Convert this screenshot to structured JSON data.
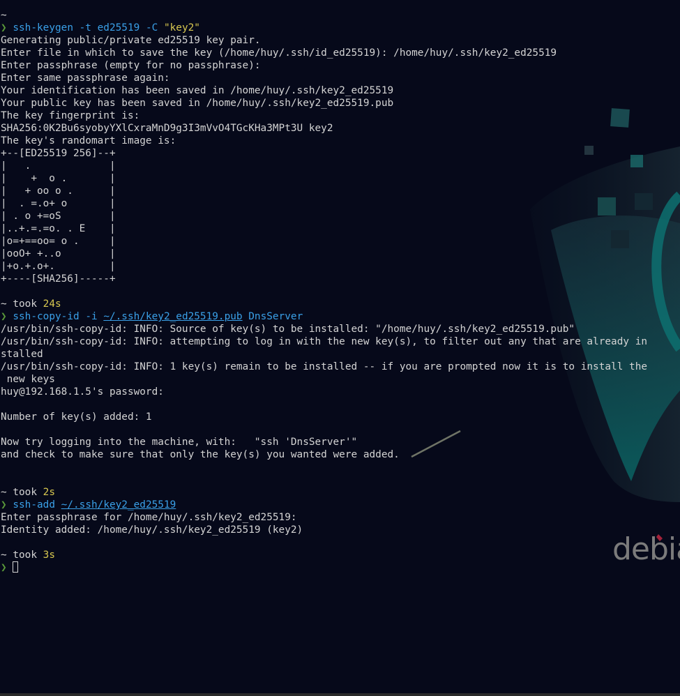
{
  "wallpaper": {
    "brand_text": "debia",
    "accent_color": "#0f4a4a"
  },
  "terminal": {
    "block1": {
      "tilde": "~",
      "prompt": "❯",
      "cmd": "ssh-keygen",
      "args": " -t ed25519 -C ",
      "str": "\"key2\"",
      "output": [
        "Generating public/private ed25519 key pair.",
        "Enter file in which to save the key (/home/huy/.ssh/id_ed25519): /home/huy/.ssh/key2_ed25519",
        "Enter passphrase (empty for no passphrase):",
        "Enter same passphrase again:",
        "Your identification has been saved in /home/huy/.ssh/key2_ed25519",
        "Your public key has been saved in /home/huy/.ssh/key2_ed25519.pub",
        "The key fingerprint is:",
        "SHA256:0K2Bu6syobyYXlCxraMnD9g3I3mVvO4TGcKHa3MPt3U key2",
        "The key's randomart image is:",
        "+--[ED25519 256]--+",
        "|   .             |",
        "|    +  o .       |",
        "|   + oo o .      |",
        "|  . =.o+ o       |",
        "| . o +=oS        |",
        "|..+.=.=o. . E    |",
        "|o=+==oo= o .     |",
        "|ooO+ +..o        |",
        "|+o.+.o+.         |",
        "+----[SHA256]-----+"
      ]
    },
    "block2": {
      "tilde": "~",
      "took": " took ",
      "dur": "24s",
      "prompt": "❯",
      "cmd": "ssh-copy-id",
      "flag": " -i ",
      "path": "~/.ssh/key2_ed25519.pub",
      "target": " DnsServer",
      "output": [
        "/usr/bin/ssh-copy-id: INFO: Source of key(s) to be installed: \"/home/huy/.ssh/key2_ed25519.pub\"",
        "/usr/bin/ssh-copy-id: INFO: attempting to log in with the new key(s), to filter out any that are already in",
        "stalled",
        "/usr/bin/ssh-copy-id: INFO: 1 key(s) remain to be installed -- if you are prompted now it is to install the",
        " new keys",
        "huy@192.168.1.5's password:",
        "",
        "Number of key(s) added: 1",
        "",
        "Now try logging into the machine, with:   \"ssh 'DnsServer'\"",
        "and check to make sure that only the key(s) you wanted were added.",
        "",
        ""
      ]
    },
    "block3": {
      "tilde": "~",
      "took": " took ",
      "dur": "2s",
      "prompt": "❯",
      "cmd": "ssh-add",
      "path": "~/.ssh/key2_ed25519",
      "output": [
        "Enter passphrase for /home/huy/.ssh/key2_ed25519:",
        "Identity added: /home/huy/.ssh/key2_ed25519 (key2)",
        ""
      ]
    },
    "block4": {
      "tilde": "~",
      "took": " took ",
      "dur": "3s",
      "prompt": "❯"
    }
  }
}
